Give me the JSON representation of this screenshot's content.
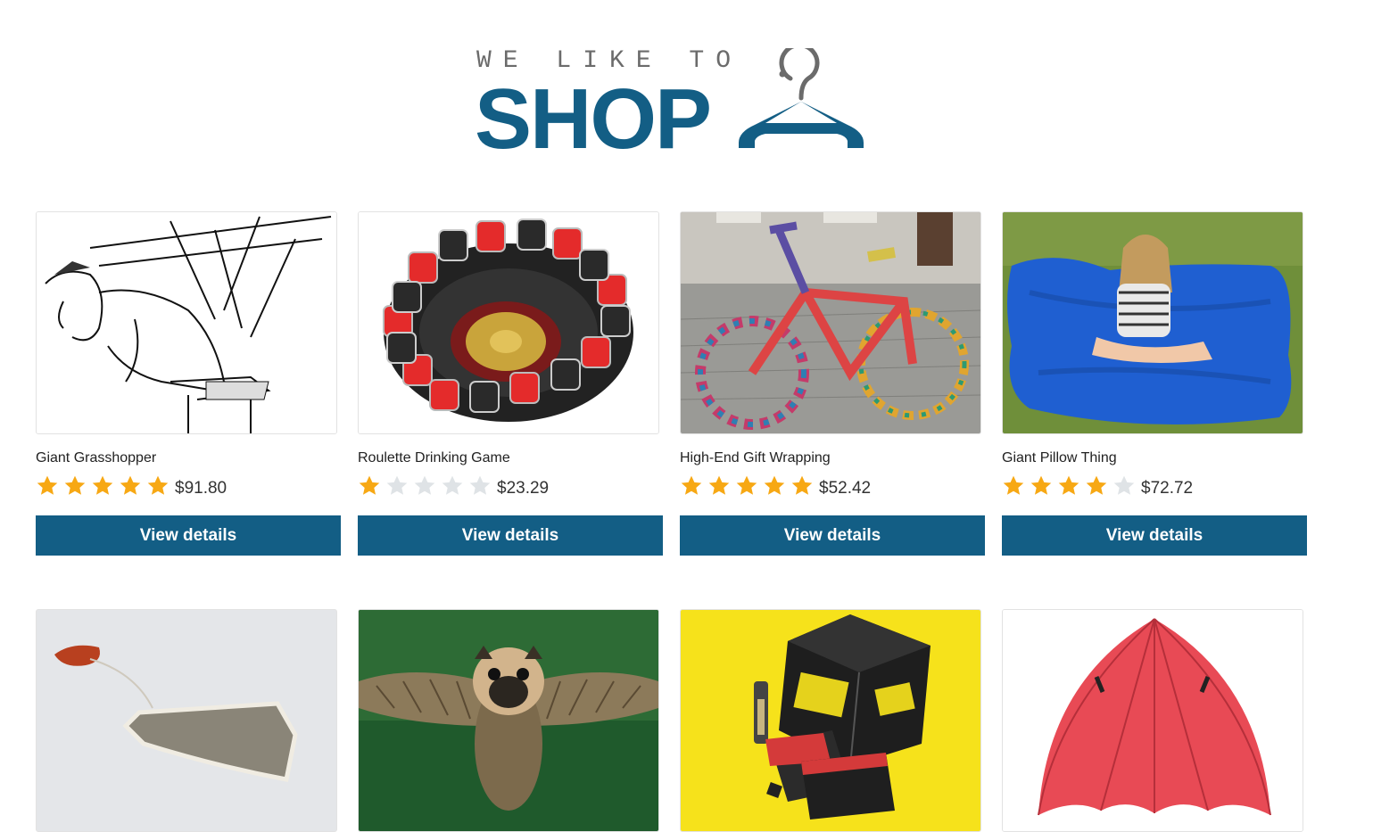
{
  "header": {
    "tagline": "WE LIKE TO",
    "wordmark": "SHOP"
  },
  "colors": {
    "brand": "#135e85",
    "star_filled": "#f7a814",
    "star_empty": "#dfe3e6"
  },
  "products": [
    {
      "title": "Giant Grasshopper",
      "rating": 5,
      "price": "$91.80",
      "button": "View details",
      "image": "grasshopper-illustration"
    },
    {
      "title": "Roulette Drinking Game",
      "rating": 1,
      "price": "$23.29",
      "button": "View details",
      "image": "roulette-shot-glasses"
    },
    {
      "title": "High-End Gift Wrapping",
      "rating": 5,
      "price": "$52.42",
      "button": "View details",
      "image": "knitted-bicycle"
    },
    {
      "title": "Giant Pillow Thing",
      "rating": 4,
      "price": "$72.72",
      "button": "View details",
      "image": "blue-bean-bag"
    },
    {
      "title": "",
      "rating": 0,
      "price": "",
      "button": "",
      "image": "tea-bag"
    },
    {
      "title": "",
      "rating": 0,
      "price": "",
      "button": "",
      "image": "flying-pug-owl"
    },
    {
      "title": "",
      "rating": 0,
      "price": "",
      "button": "",
      "image": "wtf-card-game"
    },
    {
      "title": "",
      "rating": 0,
      "price": "",
      "button": "",
      "image": "red-umbrella"
    }
  ]
}
